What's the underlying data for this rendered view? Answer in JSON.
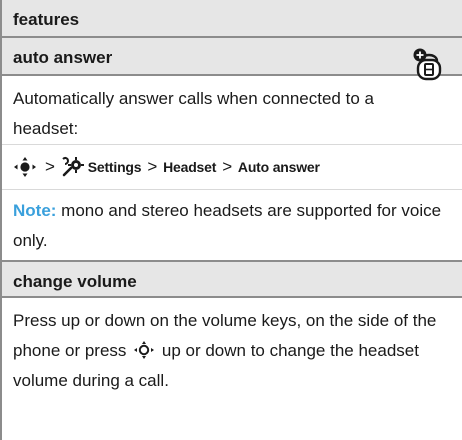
{
  "header": {
    "title": "features"
  },
  "auto_answer": {
    "heading": "auto answer",
    "description": "Automatically answer calls when connected to a headset:",
    "path": {
      "separator": ">",
      "settings_label": "Settings",
      "headset_label": "Headset",
      "auto_answer_label": "Auto answer"
    },
    "note_label": "Note:",
    "note_text": " mono and stereo headsets are supported for voice only."
  },
  "change_volume": {
    "heading": "change volume",
    "text_before": "Press up or down on the volume keys, on the side of the phone or press ",
    "text_after": " up or down to change the headset volume during a call."
  },
  "colors": {
    "note_accent": "#3aa0dc",
    "header_bg": "#e6e6e6",
    "rule": "#8c8c8c"
  },
  "icons": {
    "nav_key": "navigation-key-icon",
    "settings": "settings-gear-icon",
    "headset_feature": "headset-feature-icon"
  }
}
